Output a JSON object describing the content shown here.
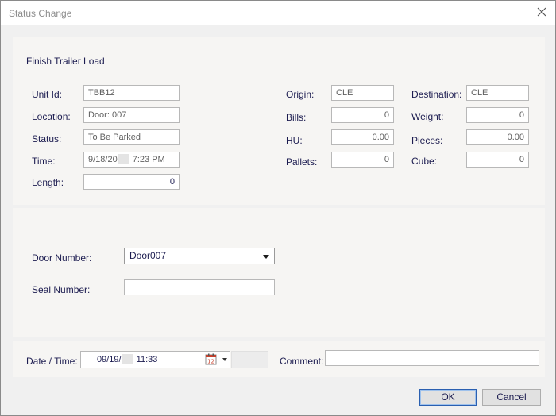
{
  "window": {
    "title": "Status Change",
    "close_icon": "close-icon"
  },
  "section": {
    "title": "Finish Trailer Load"
  },
  "fields": {
    "unit_id": {
      "label": "Unit Id:",
      "value": "TBB12"
    },
    "location": {
      "label": "Location:",
      "value": "Door: 007"
    },
    "status": {
      "label": "Status:",
      "value": "To Be Parked"
    },
    "time": {
      "label": "Time:",
      "value_prefix": "9/18/20",
      "value_suffix": " 7:23 PM"
    },
    "length": {
      "label": "Length:",
      "value": "0"
    },
    "origin": {
      "label": "Origin:",
      "value": "CLE"
    },
    "bills": {
      "label": "Bills:",
      "value": "0"
    },
    "hu": {
      "label": "HU:",
      "value": "0.00"
    },
    "pallets": {
      "label": "Pallets:",
      "value": "0"
    },
    "destination": {
      "label": "Destination:",
      "value": "CLE"
    },
    "weight": {
      "label": "Weight:",
      "value": "0"
    },
    "pieces": {
      "label": "Pieces:",
      "value": "0.00"
    },
    "cube": {
      "label": "Cube:",
      "value": "0"
    }
  },
  "door": {
    "label": "Door Number:",
    "selected": "Door007"
  },
  "seal": {
    "label": "Seal Number:",
    "value": ""
  },
  "datetime": {
    "label": "Date / Time:",
    "value_prefix": "09/19/",
    "value_suffix": " 11:33",
    "calendar_icon": "calendar-icon",
    "calendar_day": "12"
  },
  "comment": {
    "label": "Comment:",
    "value": ""
  },
  "buttons": {
    "ok": "OK",
    "cancel": "Cancel"
  }
}
